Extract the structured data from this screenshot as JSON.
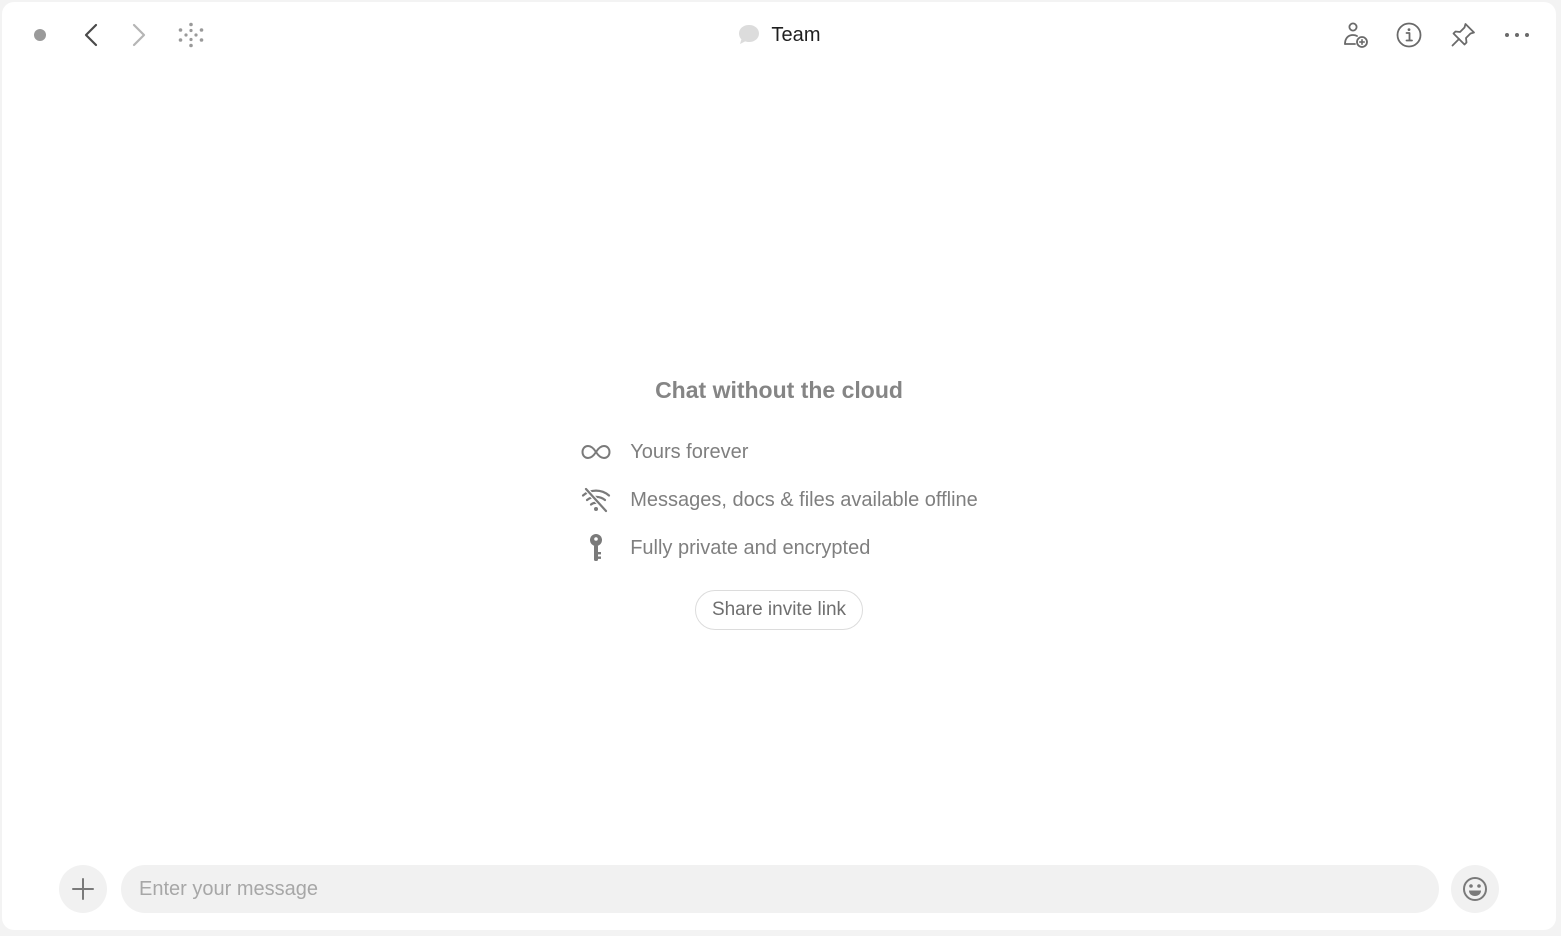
{
  "header": {
    "title": "Team",
    "icons": {
      "status": "status-dot-icon",
      "back": "chevron-left-icon",
      "forward": "chevron-right-icon",
      "graph": "graph-dots-icon",
      "chat": "chat-bubble-icon",
      "add_member": "add-member-icon",
      "info": "info-icon",
      "pin": "pin-icon",
      "more": "more-horizontal-icon"
    }
  },
  "empty_state": {
    "title": "Chat without the cloud",
    "features": [
      {
        "icon": "infinity-icon",
        "text": "Yours forever"
      },
      {
        "icon": "wifi-off-icon",
        "text": "Messages, docs & files available offline"
      },
      {
        "icon": "key-icon",
        "text": "Fully private and encrypted"
      }
    ],
    "share_label": "Share invite link"
  },
  "composer": {
    "placeholder": "Enter your message",
    "value": "",
    "add_icon": "plus-icon",
    "emoji_icon": "emoji-icon"
  },
  "colors": {
    "background": "#ffffff",
    "icon_gray": "#8a8a8a",
    "text_gray": "#7f7f7f",
    "input_bg": "#f1f1f1"
  }
}
